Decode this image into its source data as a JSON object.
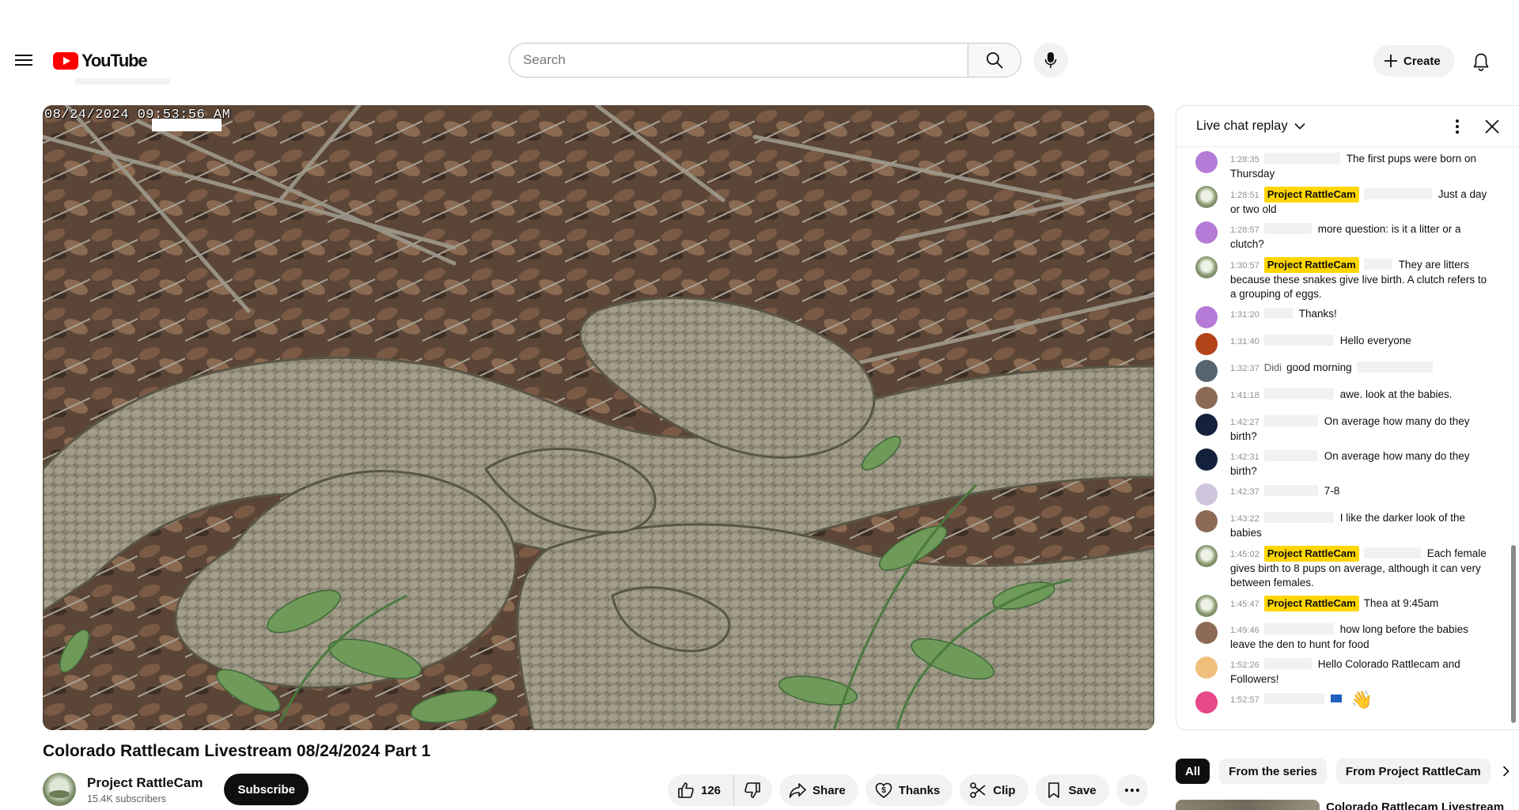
{
  "header": {
    "logo_text": "YouTube",
    "search_placeholder": "Search",
    "create_label": "Create"
  },
  "video": {
    "timestamp_overlay": "08/24/2024 09:53:56 AM",
    "title": "Colorado Rattlecam Livestream 08/24/2024 Part 1"
  },
  "channel": {
    "name": "Project RattleCam",
    "subscribers": "15.4K subscribers",
    "subscribe_label": "Subscribe"
  },
  "actions": {
    "like_count": "126",
    "share_label": "Share",
    "thanks_label": "Thanks",
    "clip_label": "Clip",
    "save_label": "Save"
  },
  "chat": {
    "mode_label": "Live chat replay",
    "messages": [
      {
        "time": "1:28:35",
        "owner": false,
        "author": "",
        "text": "The first pups were born on Thursday",
        "avatar_color": "#b57bd6",
        "redact_w": 96
      },
      {
        "time": "1:28:51",
        "owner": true,
        "author": "Project RattleCam",
        "text": "Just a day or two old",
        "avatar_color": "",
        "redact_w": 86
      },
      {
        "time": "1:28:57",
        "owner": false,
        "author": "",
        "text": "more question: is it a litter or a clutch?",
        "avatar_color": "#b57bd6",
        "redact_w": 60
      },
      {
        "time": "1:30:57",
        "owner": true,
        "author": "Project RattleCam",
        "text": "They are litters because these snakes give live birth. A clutch refers to a grouping of eggs.",
        "avatar_color": "",
        "redact_w": 36
      },
      {
        "time": "1:31:20",
        "owner": false,
        "author": "",
        "text": "Thanks!",
        "avatar_color": "#b57bd6",
        "redact_w": 36
      },
      {
        "time": "1:31:40",
        "owner": false,
        "author": "",
        "text": "Hello everyone",
        "avatar_color": "#b3441a",
        "redact_w": 88
      },
      {
        "time": "1:32:37",
        "owner": false,
        "author": "Didi",
        "text": "good morning",
        "avatar_color": "#566570",
        "redact_w": 0,
        "trail_w": 96
      },
      {
        "time": "1:41:18",
        "owner": false,
        "author": "",
        "text": "awe. look at the babies.",
        "avatar_color": "#8c6a55",
        "redact_w": 88
      },
      {
        "time": "1:42:27",
        "owner": false,
        "author": "",
        "text": "On average how many do they birth?",
        "avatar_color": "#14213d",
        "redact_w": 68
      },
      {
        "time": "1:42:31",
        "owner": false,
        "author": "",
        "text": "On average how many do they birth?",
        "avatar_color": "#14213d",
        "redact_w": 68
      },
      {
        "time": "1:42:37",
        "owner": false,
        "author": "",
        "text": "7-8",
        "avatar_color": "#cfc6dd",
        "redact_w": 68
      },
      {
        "time": "1:43:22",
        "owner": false,
        "author": "",
        "text": "I like the darker look of the babies",
        "avatar_color": "#8c6a55",
        "redact_w": 88
      },
      {
        "time": "1:45:02",
        "owner": true,
        "author": "Project RattleCam",
        "text": "Each female gives birth to 8 pups on average, although it can very between females.",
        "avatar_color": "",
        "redact_w": 72
      },
      {
        "time": "1:45:47",
        "owner": true,
        "author": "Project RattleCam",
        "text": "Thea at 9:45am",
        "avatar_color": "",
        "redact_w": 0
      },
      {
        "time": "1:49:46",
        "owner": false,
        "author": "",
        "text": "how long before the babies leave the den to hunt for food",
        "avatar_color": "#8c6a55",
        "redact_w": 88
      },
      {
        "time": "1:52:26",
        "owner": false,
        "author": "",
        "text": "Hello Colorado Rattlecam and Followers!",
        "avatar_color": "#efc07d",
        "redact_w": 60
      },
      {
        "time": "1:52:57",
        "owner": false,
        "author": "",
        "text": "",
        "avatar_color": "#e6488a",
        "redact_w": 76,
        "emoji": "👋"
      }
    ]
  },
  "chips": {
    "items": [
      "All",
      "From the series",
      "From Project RattleCam"
    ]
  },
  "recommendation": {
    "title": "Colorado Rattlecam Livestream"
  }
}
